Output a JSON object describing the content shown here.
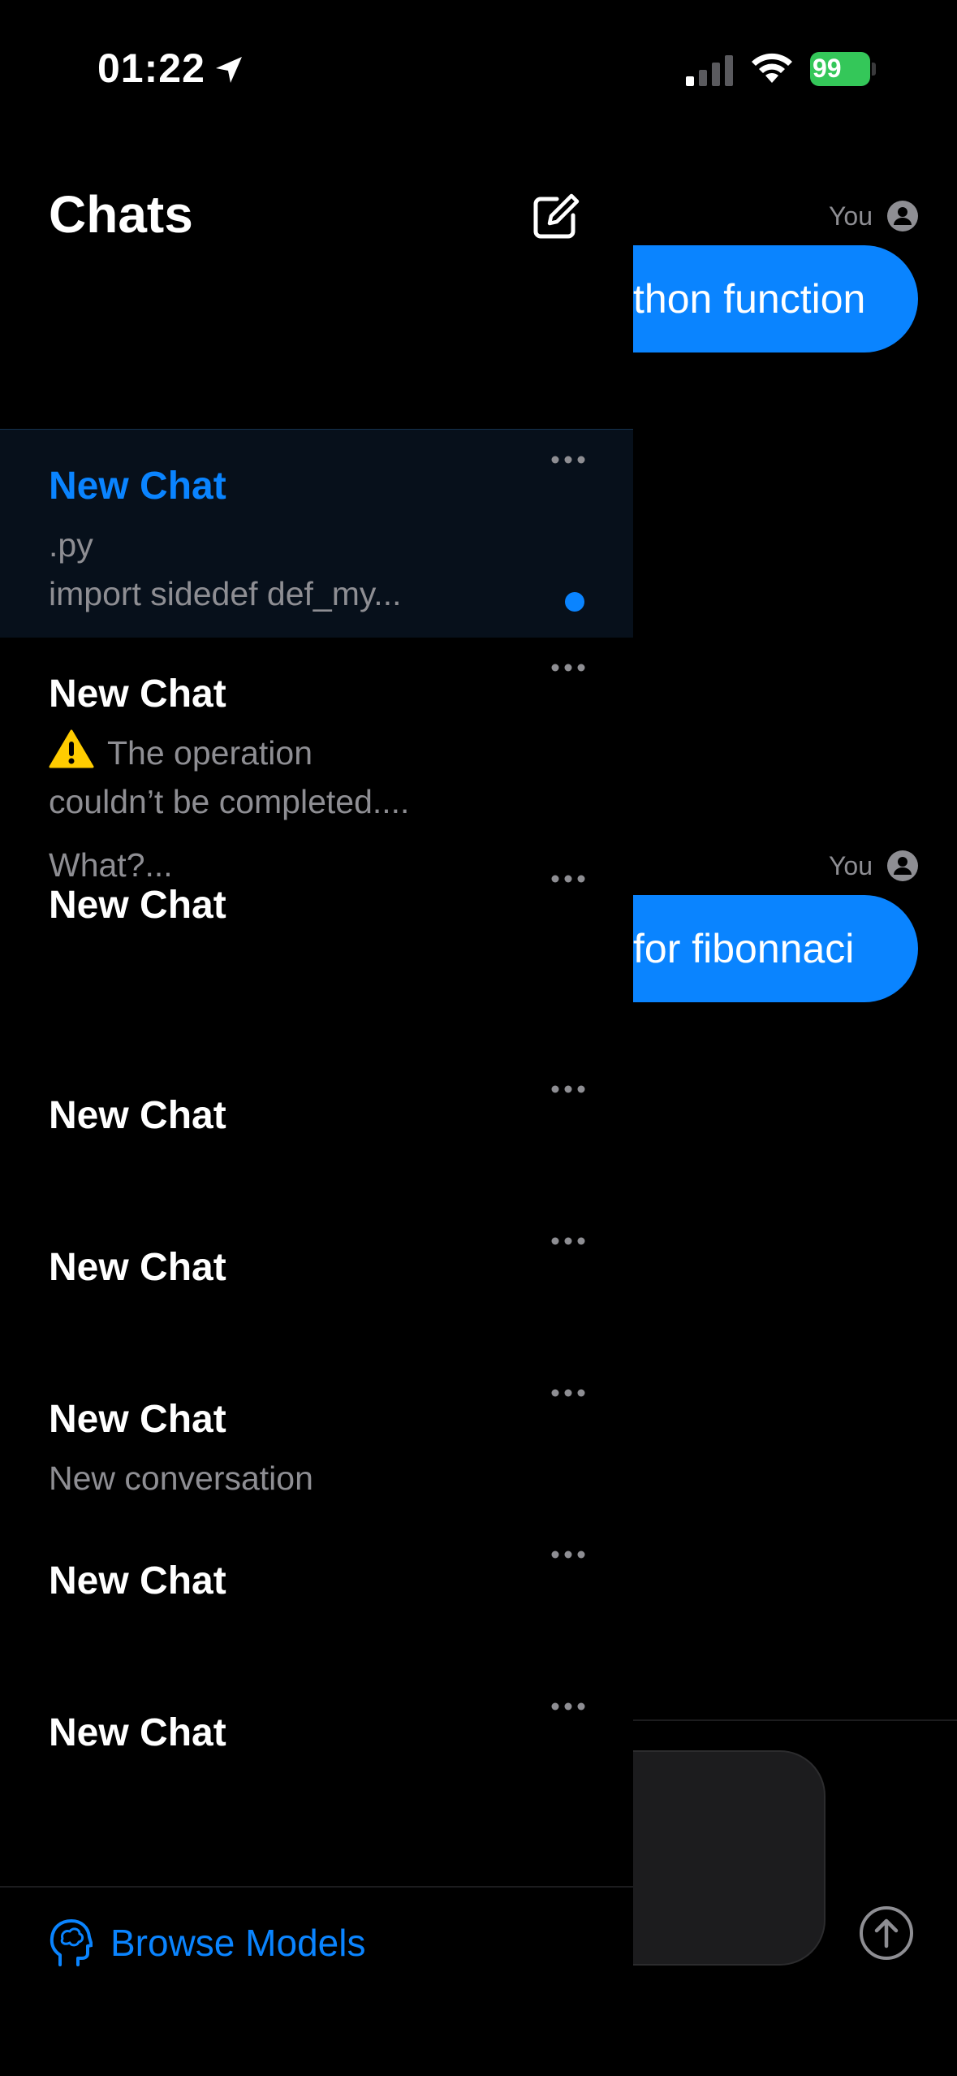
{
  "status_bar": {
    "time": "01:22",
    "battery": "99"
  },
  "sidebar": {
    "title": "Chats",
    "chats": [
      {
        "title": "New Chat",
        "preview_lines": [
          ".py",
          "import sidedef def_my..."
        ],
        "unread": true,
        "selected": true
      },
      {
        "title": "New Chat",
        "warning": true,
        "preview_lines": [
          "The operation",
          "couldn’t be completed...."
        ]
      },
      {
        "title": "New Chat",
        "preview_lines": []
      },
      {
        "title": "New Chat",
        "preview_lines": []
      },
      {
        "title": "New Chat",
        "preview_lines": []
      },
      {
        "title": "New Chat",
        "preview_lines": [
          "New conversation"
        ]
      },
      {
        "title": "New Chat",
        "preview_lines": []
      },
      {
        "title": "New Chat",
        "preview_lines": []
      }
    ],
    "stray_preview": "What?...",
    "browse_models_label": "Browse Models"
  },
  "chat": {
    "messages": [
      {
        "sender": "You",
        "text": "thon function"
      },
      {
        "sender": "You",
        "text": "for fibonnaci"
      }
    ]
  },
  "colors": {
    "accent": "#0a84ff",
    "battery": "#34c759",
    "selected_bg": "#07101b",
    "secondary_text": "#8e8e93"
  }
}
